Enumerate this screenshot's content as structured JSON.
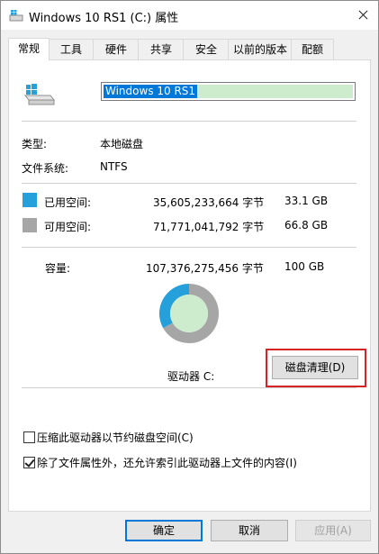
{
  "window": {
    "title": "Windows 10 RS1 (C:) 属性"
  },
  "tabs": [
    {
      "label": "常规",
      "active": true
    },
    {
      "label": "工具"
    },
    {
      "label": "硬件"
    },
    {
      "label": "共享"
    },
    {
      "label": "安全"
    },
    {
      "label": "以前的版本"
    },
    {
      "label": "配额"
    }
  ],
  "general": {
    "volume_name": "Windows 10 RS1",
    "type_label": "类型:",
    "type_value": "本地磁盘",
    "fs_label": "文件系统:",
    "fs_value": "NTFS",
    "used": {
      "label": "已用空间:",
      "bytes": "35,605,233,664 字节",
      "size": "33.1 GB",
      "color": "#26a0da",
      "fraction": 0.332
    },
    "free": {
      "label": "可用空间:",
      "bytes": "71,771,041,792 字节",
      "size": "66.8 GB",
      "color": "#a6a6a6",
      "fraction": 0.668
    },
    "capacity": {
      "label": "容量:",
      "bytes": "107,376,275,456 字节",
      "size": "100 GB"
    },
    "drive_label": "驱动器 C:",
    "cleanup_button": "磁盘清理(D)",
    "compress_label": "压缩此驱动器以节约磁盘空间(C)",
    "compress_checked": false,
    "index_label": "除了文件属性外，还允许索引此驱动器上文件的内容(I)",
    "index_checked": true
  },
  "footer": {
    "ok": "确定",
    "cancel": "取消",
    "apply": "应用(A)"
  },
  "icons": {
    "title": "drive-icon",
    "close": "close-icon",
    "drive": "windows-drive-icon"
  }
}
